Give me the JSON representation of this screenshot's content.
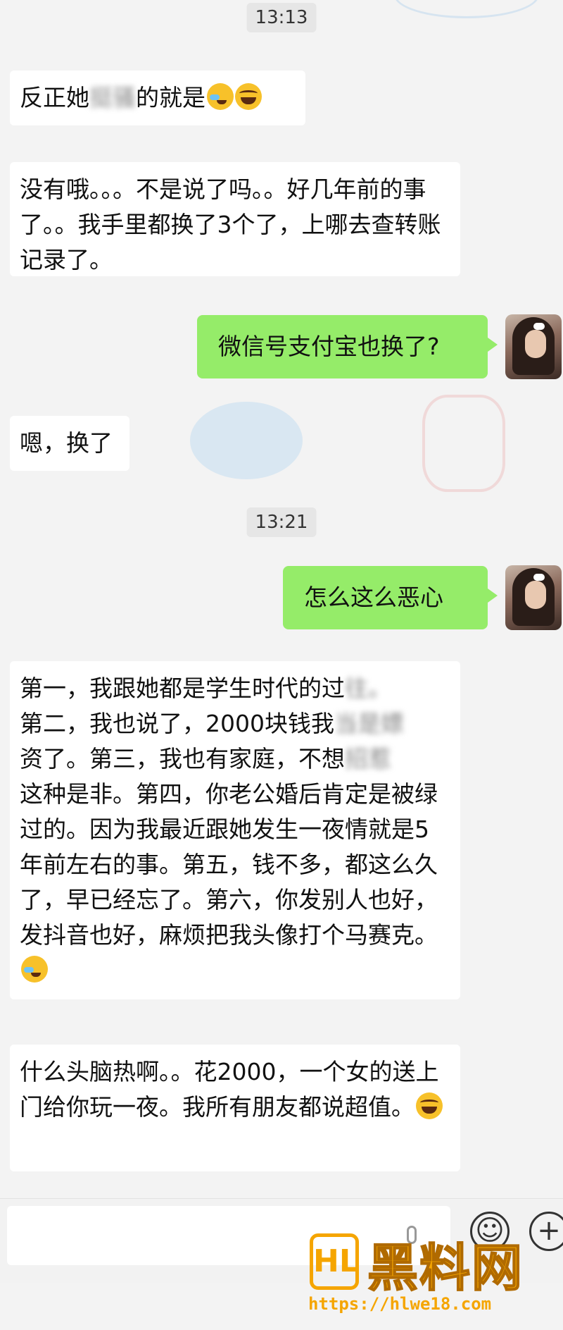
{
  "chat": {
    "time1": "13:13",
    "msg1": "反正她",
    "msg1_blur": "挺骚",
    "msg1_tail": "的就是",
    "msg2": "没有哦。。。不是说了吗。。好几年前的事了。。我手里都换了3个了，上哪去查转账记录了。",
    "msg3": "微信号支付宝也换了?",
    "msg4": "嗯，换了",
    "time2": "13:21",
    "msg5": "怎么这么恶心",
    "msg6_l1a": "第一，我跟她都是学生时代的过",
    "msg6_l1b": "往。",
    "msg6_l2a": "第二，我也说了，2000块钱我",
    "msg6_l2b": "当是嫖",
    "msg6_l3a": "资了。第三，我也有家庭，不想",
    "msg6_l3b": "招惹",
    "msg6_rest": "这种是非。第四，你老公婚后肯定是被绿过的。因为我最近跟她发生一夜情就是5年前左右的事。第五，钱不多，都这么久了，早已经忘了。第六，你发别人也好，发抖音也好，麻烦把我头像打个马赛克。",
    "msg7": "什么头脑热啊。。花2000，一个女的送上门给你玩一夜。我所有朋友都说超值。"
  },
  "icons": {
    "laugh": "laughing-emoji-icon",
    "cry": "crying-laughing-emoji-icon",
    "smile": "emoji-button-icon",
    "plus": "plus-icon",
    "mic": "voice-icon"
  },
  "watermark": {
    "logo": "HL",
    "name": "黑料网",
    "url": "https://hlwe18.com"
  },
  "colors": {
    "sent_bubble": "#95ec69",
    "received_bubble": "#ffffff",
    "watermark": "#f5a500"
  }
}
